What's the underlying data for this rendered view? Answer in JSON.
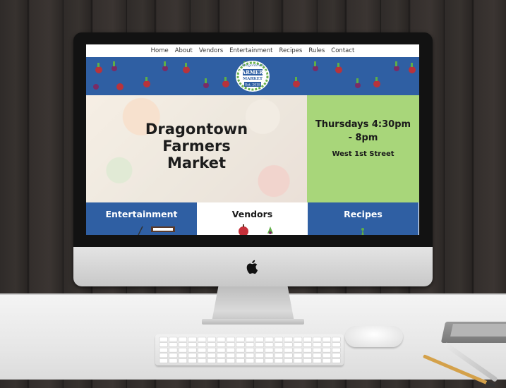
{
  "nav": {
    "items": [
      "Home",
      "About",
      "Vendors",
      "Entertainment",
      "Recipes",
      "Rules",
      "Contact"
    ]
  },
  "logo": {
    "top": "Dragontown",
    "main": "FARMERS",
    "sub": "MARKET",
    "est": "Est. 2018"
  },
  "hero": {
    "title_line1": "Dragontown",
    "title_line2": "Farmers",
    "title_line3": "Market",
    "when_line1": "Thursdays 4:30pm",
    "when_line2": "- 8pm",
    "where": "West 1st Street"
  },
  "tiles": [
    {
      "label": "Entertainment",
      "color": "#2f5fa3"
    },
    {
      "label": "Vendors",
      "color": "#ffffff"
    },
    {
      "label": "Recipes",
      "color": "#2f5fa3"
    }
  ],
  "colors": {
    "brand_blue": "#2f5fa3",
    "brand_green": "#a8d67a",
    "logo_green": "#6ab04c"
  },
  "icons": [
    "apple-logo-icon",
    "beet-icon",
    "apple-icon",
    "keyboard-icon"
  ]
}
